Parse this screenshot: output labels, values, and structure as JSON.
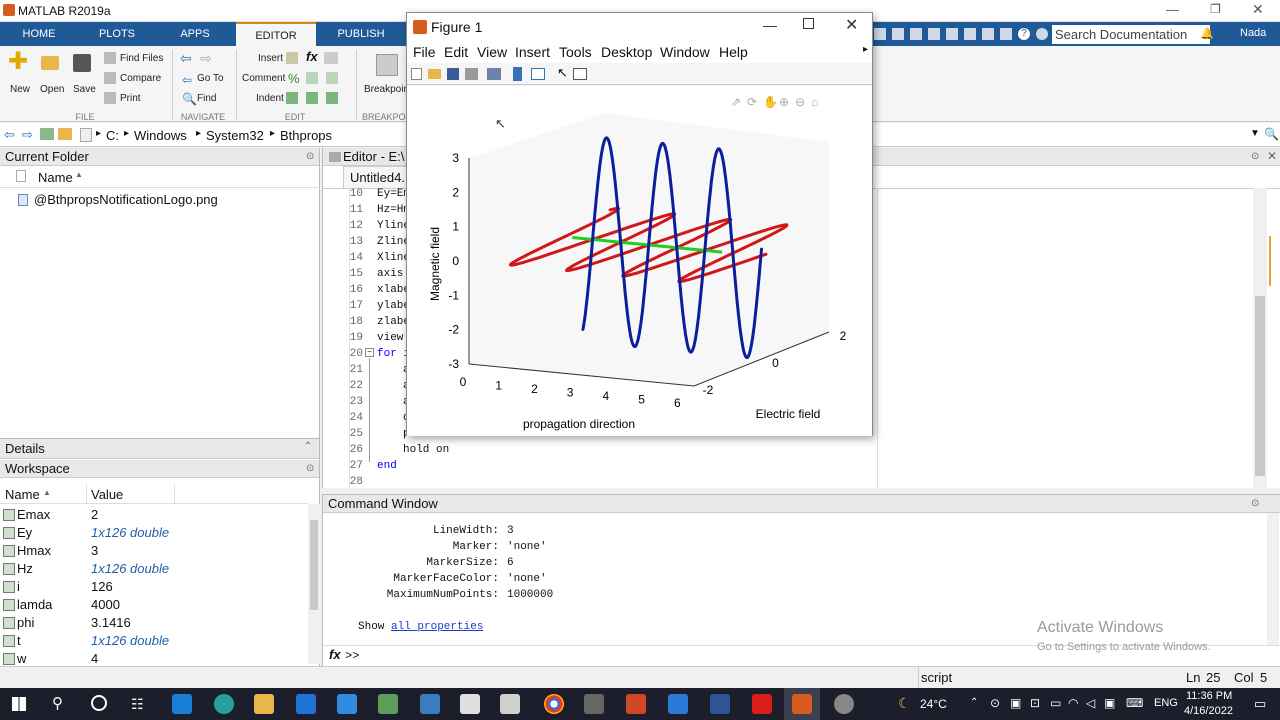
{
  "window": {
    "title": "MATLAB R2019a"
  },
  "ribbon_tabs": [
    "HOME",
    "PLOTS",
    "APPS",
    "EDITOR",
    "PUBLISH"
  ],
  "ribbon": {
    "new": "New",
    "open": "Open",
    "save": "Save",
    "find_files": "Find Files",
    "compare": "Compare",
    "print": "Print",
    "go_to": "Go To",
    "find": "Find",
    "insert": "Insert",
    "comment": "Comment",
    "indent": "Indent",
    "breakpoints": "Breakpoints",
    "section_file": "FILE",
    "section_navigate": "NAVIGATE",
    "section_edit": "EDIT",
    "section_breakpoints": "BREAKPOI",
    "search_placeholder": "Search Documentation",
    "user": "Nada"
  },
  "address": {
    "segments": [
      "C:",
      "Windows",
      "System32",
      "Bthprops"
    ]
  },
  "current_folder": {
    "title": "Current Folder",
    "col_name": "Name",
    "files": [
      "@BthpropsNotificationLogo.png"
    ]
  },
  "details": {
    "title": "Details"
  },
  "workspace": {
    "title": "Workspace",
    "col_name": "Name",
    "col_value": "Value",
    "rows": [
      {
        "name": "Emax",
        "value": "2"
      },
      {
        "name": "Ey",
        "value": "1x126 double"
      },
      {
        "name": "Hmax",
        "value": "3"
      },
      {
        "name": "Hz",
        "value": "1x126 double"
      },
      {
        "name": "i",
        "value": "126"
      },
      {
        "name": "lamda",
        "value": "4000"
      },
      {
        "name": "phi",
        "value": "3.1416"
      },
      {
        "name": "t",
        "value": "1x126 double"
      },
      {
        "name": "w",
        "value": "4"
      }
    ]
  },
  "editor": {
    "title": "Editor - E:\\",
    "tab": "Untitled4.",
    "lines": [
      {
        "n": "10",
        "code": "Ey=Em"
      },
      {
        "n": "11",
        "code": "Hz=Hm"
      },
      {
        "n": "12",
        "code": "Yline"
      },
      {
        "n": "13",
        "code": "Zline"
      },
      {
        "n": "14",
        "code": "Xline"
      },
      {
        "n": "15",
        "code": "axis"
      },
      {
        "n": "16",
        "code": "xlabe"
      },
      {
        "n": "17",
        "code": "ylabe"
      },
      {
        "n": "18",
        "code": "zlabe"
      },
      {
        "n": "19",
        "code": "view"
      },
      {
        "n": "20",
        "code": "for i"
      },
      {
        "n": "21",
        "code": "a"
      },
      {
        "n": "22",
        "code": "a"
      },
      {
        "n": "23",
        "code": "a"
      },
      {
        "n": "24",
        "code": "c"
      },
      {
        "n": "25",
        "code": "p"
      },
      {
        "n": "26",
        "code": "hold on"
      },
      {
        "n": "27",
        "code": "end"
      },
      {
        "n": "28",
        "code": ""
      }
    ]
  },
  "command_window": {
    "title": "Command Window",
    "props": [
      {
        "k": "LineWidth:",
        "v": "3"
      },
      {
        "k": "Marker:",
        "v": "'none'"
      },
      {
        "k": "MarkerSize:",
        "v": "6"
      },
      {
        "k": "MarkerFaceColor:",
        "v": "'none'"
      },
      {
        "k": "MaximumNumPoints:",
        "v": "1000000"
      }
    ],
    "show": "Show",
    "all_properties": "all properties",
    "prompt": ">>"
  },
  "activation": {
    "title": "Activate Windows",
    "sub": "Go to Settings to activate Windows."
  },
  "status": {
    "mode": "script",
    "ln": "Ln",
    "ln_v": "25",
    "col": "Col",
    "col_v": "5"
  },
  "taskbar": {
    "temp": "24°C",
    "lang": "ENG",
    "time": "11:36 PM",
    "date": "4/16/2022"
  },
  "figure": {
    "title": "Figure 1",
    "menu": [
      "File",
      "Edit",
      "View",
      "Insert",
      "Tools",
      "Desktop",
      "Window",
      "Help"
    ],
    "zlabel": "Magnetic field",
    "xlabel": "propagation direction",
    "ylabel": "Electric field",
    "ztick_labels": [
      "3",
      "2",
      "1",
      "0",
      "-1",
      "-2",
      "-3"
    ],
    "xtick_labels": [
      "0",
      "1",
      "2",
      "3",
      "4",
      "5",
      "6"
    ],
    "ytick_labels": [
      "-2",
      "0",
      "2"
    ],
    "colors": {
      "magnetic": "#0a1f9c",
      "electric": "#d01818",
      "axis": "#22cc22"
    }
  },
  "chart_data": {
    "type": "line",
    "xlabel": "propagation direction",
    "ylabel": "Electric field",
    "zlabel": "Magnetic field",
    "xlim": [
      0,
      6.3
    ],
    "ylim": [
      -2,
      2
    ],
    "zlim": [
      -3,
      3
    ],
    "series": [
      {
        "description": "Hz = 3*sin(4x) in x-z plane",
        "color": "#0a1f9c",
        "amplitude": 3,
        "frequency": 4
      },
      {
        "description": "Ey = 2*sin(4x) in x-y plane",
        "color": "#d01818",
        "amplitude": 2,
        "frequency": 4
      },
      {
        "description": "propagation axis line",
        "color": "#22cc22"
      }
    ]
  }
}
